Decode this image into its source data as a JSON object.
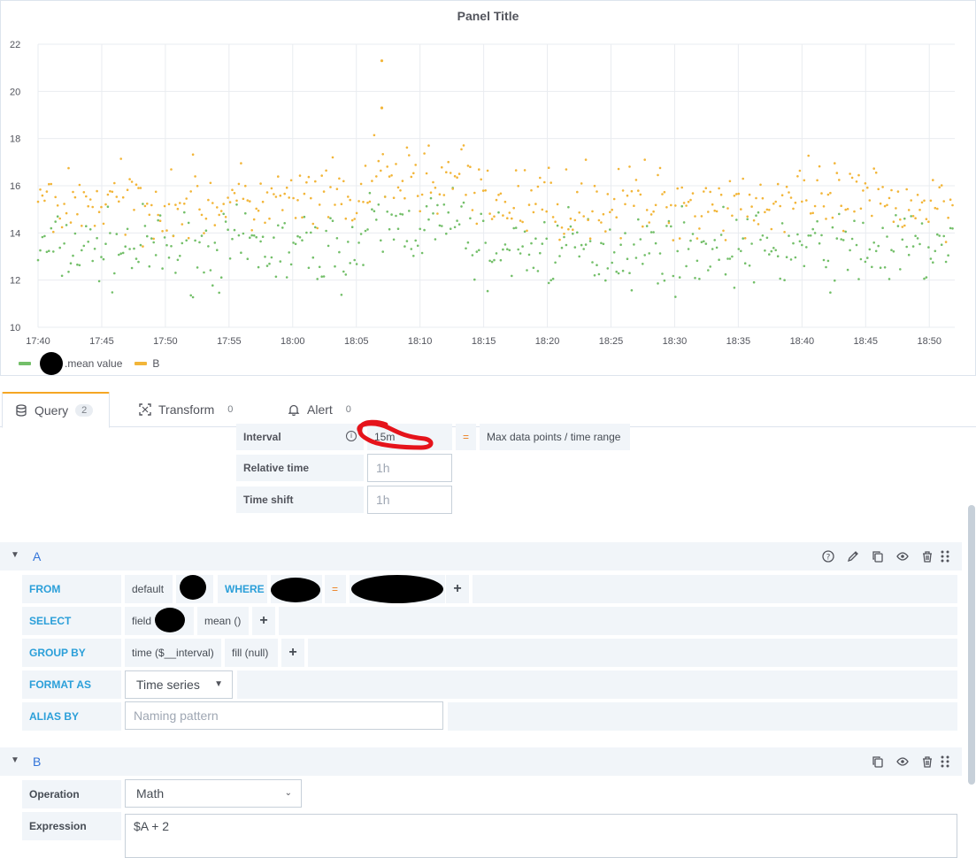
{
  "panel": {
    "title": "Panel Title",
    "legend": [
      {
        "label": ".mean value",
        "color": "#73bf69"
      },
      {
        "label": "B",
        "color": "#f2b538"
      }
    ]
  },
  "chart_data": {
    "type": "scatter",
    "title": "Panel Title",
    "xlabel": "",
    "ylabel": "",
    "x_ticks": [
      "17:40",
      "17:45",
      "17:50",
      "17:55",
      "18:00",
      "18:05",
      "18:10",
      "18:15",
      "18:20",
      "18:25",
      "18:30",
      "18:35",
      "18:40",
      "18:45",
      "18:50"
    ],
    "y_ticks": [
      10,
      12,
      14,
      16,
      18,
      20,
      22
    ],
    "ylim": [
      10,
      22
    ],
    "xlim": [
      "17:40",
      "18:52"
    ],
    "grid": true,
    "legend_placement": "bottom-left",
    "series": [
      {
        "name": ".mean value",
        "color": "#73bf69",
        "mean_y": 13.3,
        "spread": 1.2
      },
      {
        "name": "B",
        "color": "#f2b538",
        "mean_y": 15.3,
        "spread": 1.2,
        "outliers": [
          {
            "x": "18:07",
            "y": 21.3
          },
          {
            "x": "18:07",
            "y": 19.3
          }
        ]
      }
    ]
  },
  "tabs": [
    {
      "label": "Query",
      "count": "2",
      "icon": "database-icon"
    },
    {
      "label": "Transform",
      "count": "0",
      "icon": "transform-icon"
    },
    {
      "label": "Alert",
      "count": "0",
      "icon": "bell-icon"
    }
  ],
  "options": {
    "interval_label": "Interval",
    "interval_value": "15m",
    "equals": "=",
    "max_points_label": "Max data points / time range",
    "relative_time_label": "Relative time",
    "relative_time_placeholder": "1h",
    "time_shift_label": "Time shift",
    "time_shift_placeholder": "1h"
  },
  "query_a": {
    "name": "A",
    "from_kw": "FROM",
    "from_policy": "default",
    "where_kw": "WHERE",
    "where_op": "=",
    "select_kw": "SELECT",
    "select_field": "field",
    "select_field_suffix": ")",
    "select_fn": "mean ()",
    "groupby_kw": "GROUP BY",
    "groupby_time": "time ($__interval)",
    "groupby_fill": "fill (null)",
    "format_kw": "FORMAT AS",
    "format_value": "Time series",
    "alias_kw": "ALIAS BY",
    "alias_placeholder": "Naming pattern",
    "plus": "+"
  },
  "query_b": {
    "name": "B",
    "operation_label": "Operation",
    "operation_value": "Math",
    "expression_label": "Expression",
    "expression_value": "$A + 2"
  }
}
